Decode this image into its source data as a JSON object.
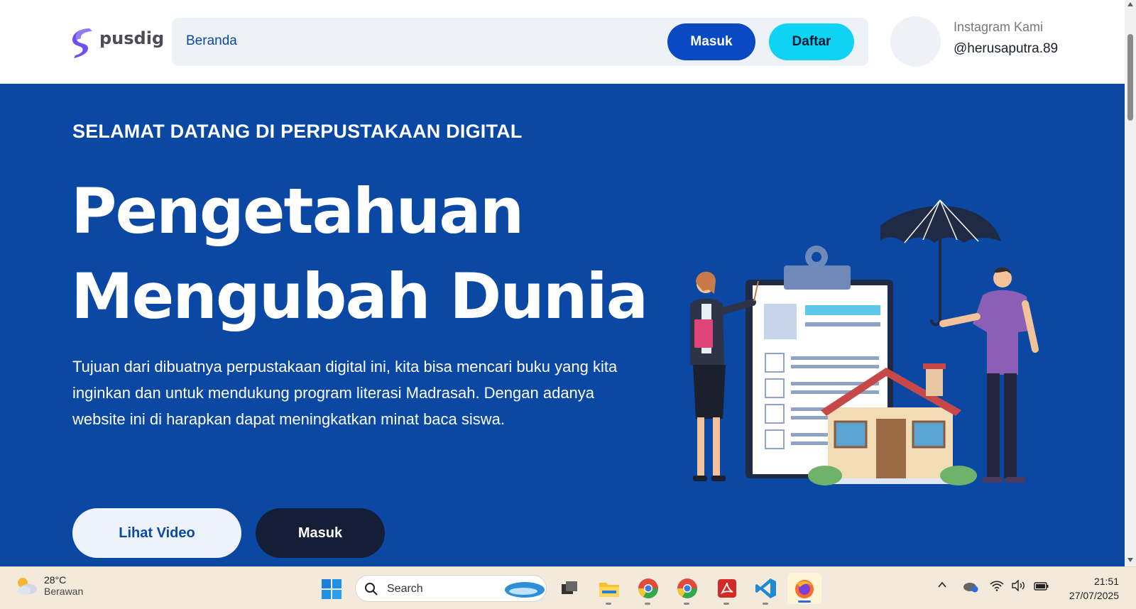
{
  "navbar": {
    "logo_text": "pusdig",
    "nav_link": "Beranda",
    "login_label": "Masuk",
    "register_label": "Daftar",
    "instagram_label": "Instagram Kami",
    "instagram_handle": "@herusaputra.89"
  },
  "hero": {
    "eyebrow": "SELAMAT DATANG DI PERPUSTAKAAN DIGITAL",
    "headline_line1": "Pengetahuan",
    "headline_line2": "Mengubah Dunia",
    "description": "Tujuan dari dibuatnya perpustakaan digital ini, kita bisa mencari buku yang kita inginkan dan untuk mendukung program literasi Madrasah. Dengan adanya website ini di harapkan dapat meningkatkan minat baca siswa.",
    "video_button": "Lihat Video",
    "login_button": "Masuk"
  },
  "taskbar": {
    "weather_temp": "28°C",
    "weather_desc": "Berawan",
    "search_placeholder": "Search",
    "time": "21:51",
    "date": "27/07/2025",
    "apps": [
      "task-view",
      "file-explorer",
      "chrome",
      "chrome",
      "acrobat",
      "vscode",
      "firefox"
    ]
  },
  "colors": {
    "hero_bg": "#0b48a3",
    "primary_button": "#0b49c2",
    "accent_cyan": "#0fd3f3",
    "dark_button": "#141e36"
  }
}
